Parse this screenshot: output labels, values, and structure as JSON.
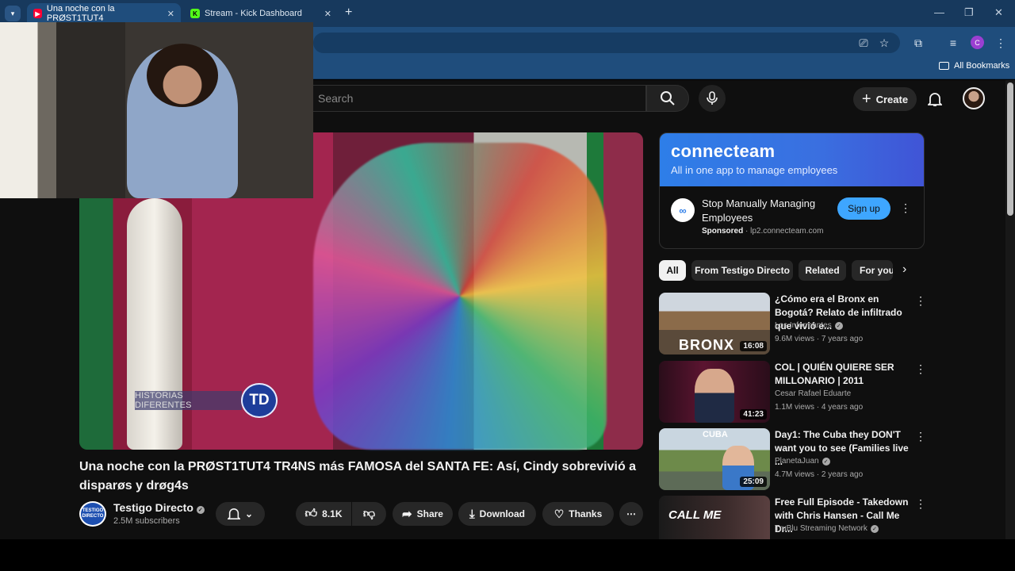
{
  "browser": {
    "tabs": [
      {
        "label": "Una noche con la PRØST1TUT4",
        "close": "✕"
      },
      {
        "label": "Stream - Kick Dashboard",
        "close": "✕"
      }
    ],
    "new_tab": "+",
    "window_controls": {
      "minimize": "—",
      "maximize": "❐",
      "close": "✕"
    },
    "profile_initial": "C",
    "bookmarks_label": "All Bookmarks"
  },
  "youtube": {
    "search_placeholder": "Search",
    "create_label": "Create",
    "video": {
      "watermark": "HISTORIAS DIFERENTES",
      "watermark_badge": "TD",
      "title": "Una noche con la PRØST1TUT4 TR4NS más FAMOSA del SANTA FE: Así, Cindy sobrevivió a disparøs y drøg4s",
      "channel": "Testigo Directo",
      "channel_avatar_text": "TESTIGO DIRECTO",
      "subscribers": "2.5M subscribers",
      "likes": "8.1K",
      "share": "Share",
      "download": "Download",
      "thanks": "Thanks"
    },
    "ad": {
      "brand": "connecteam",
      "tagline": "All in one app to manage employees",
      "headline": "Stop Manually Managing Employees",
      "sponsored": "Sponsored",
      "domain": "lp2.connecteam.com",
      "cta": "Sign up"
    },
    "chips": [
      "All",
      "From Testigo Directo",
      "Related",
      "For you"
    ],
    "recommendations": [
      {
        "title": "¿Cómo era el Bronx en Bogotá? Relato de infiltrado que vivió e...",
        "channel": "Los Informantes",
        "verified": true,
        "views": "9.6M views",
        "age": "7 years ago",
        "duration": "16:08",
        "thumb_text": "BRONX"
      },
      {
        "title": "COL | QUIÉN QUIERE SER MILLONARIO | 2011",
        "channel": "Cesar Rafael Eduarte",
        "verified": false,
        "views": "1.1M views",
        "age": "4 years ago",
        "duration": "41:23",
        "thumb_text": ""
      },
      {
        "title": "Day1: The Cuba they DON'T want you to see (Families live ...",
        "channel": "PlanetaJuan",
        "verified": true,
        "views": "4.7M views",
        "age": "2 years ago",
        "duration": "25:09",
        "thumb_text": "CUBA"
      },
      {
        "title": "Free Full Episode - Takedown with Chris Hansen - Call Me Dr...",
        "channel": "TruBlu Streaming Network",
        "verified": true,
        "views": "",
        "age": "",
        "duration": "",
        "thumb_text": "CALL ME"
      }
    ]
  }
}
